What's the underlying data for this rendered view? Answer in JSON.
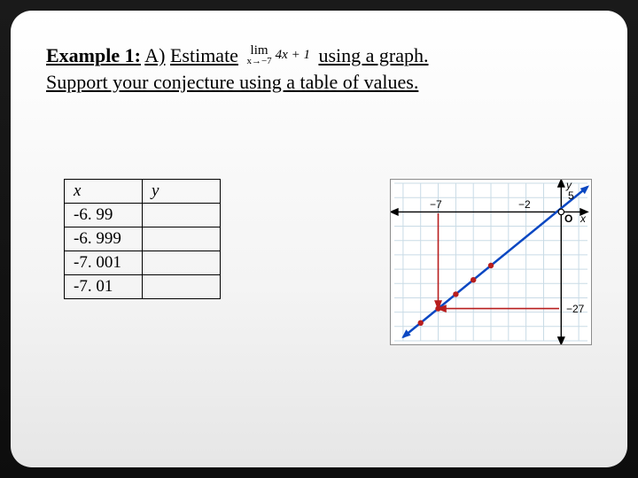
{
  "prompt": {
    "label": "Example 1:",
    "part": "A)",
    "verb": "Estimate",
    "limit_top": "lim",
    "limit_sub": "x→−7",
    "limit_func": "4x + 1",
    "after_limit": "using a graph.",
    "line2": "Support your conjecture using a table of values."
  },
  "table": {
    "headers": {
      "x": "x",
      "y": "y"
    },
    "rows": [
      {
        "x": "-6. 99",
        "y": ""
      },
      {
        "x": "-6. 999",
        "y": ""
      },
      {
        "x": "-7. 001",
        "y": ""
      },
      {
        "x": "-7. 01",
        "y": ""
      }
    ]
  },
  "graph": {
    "axis_y_label": "y",
    "axis_x_label": "x",
    "x_tick_labels": {
      "neg7": "−7",
      "neg2": "−2"
    },
    "y_tick_labels": {
      "pos5": "5",
      "neg27": "−27"
    },
    "origin_label": "O",
    "line_color": "#0a47c2",
    "point_color": "#b81e1e"
  },
  "chart_data": {
    "type": "line",
    "title": "",
    "xlabel": "x",
    "ylabel": "y",
    "xlim": [
      -9.5,
      1.5
    ],
    "ylim": [
      -36,
      8
    ],
    "x_ticks": [
      -7,
      -2
    ],
    "y_ticks": [
      5,
      -27
    ],
    "series": [
      {
        "name": "y = 4x + 1",
        "type": "line",
        "x": [
          -9,
          1.5
        ],
        "y": [
          -35,
          7
        ]
      }
    ],
    "points": [
      {
        "x": -7,
        "y": -27
      },
      {
        "x": -6,
        "y": -23
      },
      {
        "x": -5,
        "y": -19
      },
      {
        "x": -4,
        "y": -15
      },
      {
        "x": -8,
        "y": -31
      }
    ]
  }
}
